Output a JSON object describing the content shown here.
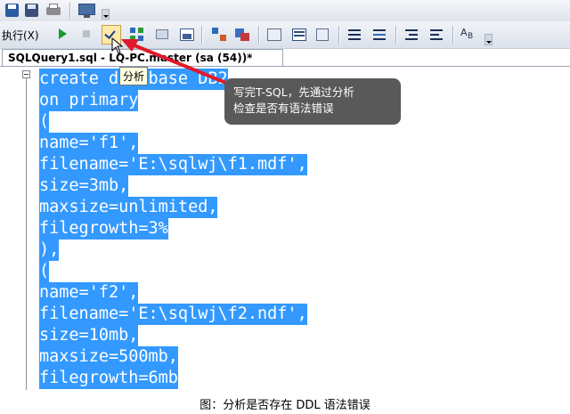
{
  "toolbar": {
    "execute_label": "执行(X)"
  },
  "tab": {
    "title": "SQLQuery1.sql - LQ-PC.master (sa (54))*"
  },
  "tooltip": {
    "text": "分析"
  },
  "callout": {
    "line1": "写完T-SQL，先通过分析",
    "line2": "检查是否有语法错误"
  },
  "code_lines": [
    "create database DB2",
    "on primary",
    "(",
    "name='f1',",
    "filename='E:\\sqlwj\\f1.mdf',",
    "size=3mb,",
    "maxsize=unlimited,",
    "filegrowth=3%",
    "),",
    "(",
    "name='f2',",
    "filename='E:\\sqlwj\\f2.ndf',",
    "size=10mb,",
    "maxsize=500mb,",
    "filegrowth=6mb"
  ],
  "caption": "图：分析是否存在 DDL 语法错误",
  "colors": {
    "selection": "#3399ff",
    "arrow": "#e0192b",
    "callout_bg": "#595959"
  }
}
